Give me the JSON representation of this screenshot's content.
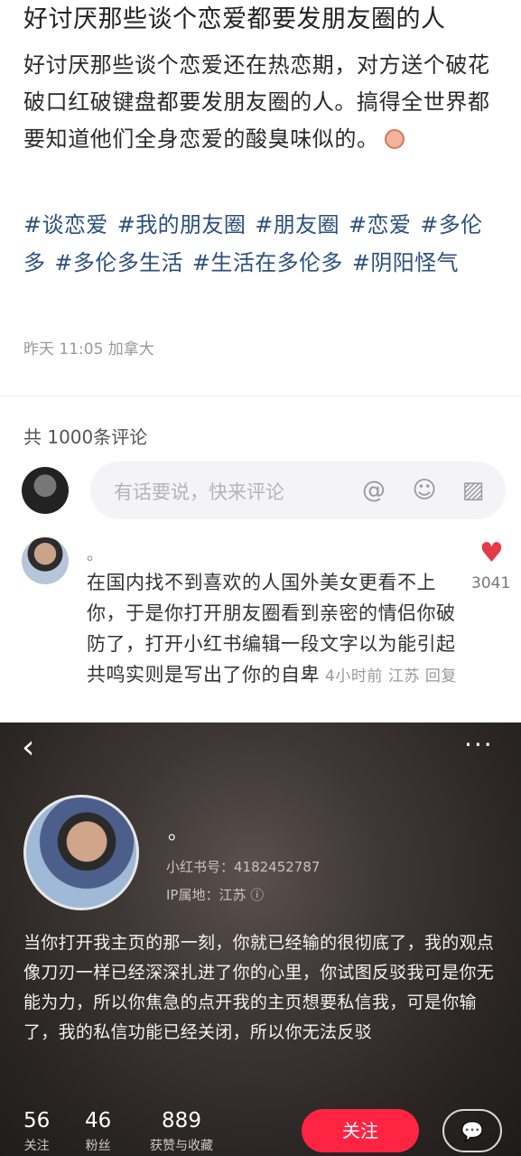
{
  "post": {
    "title": "好讨厌那些谈个恋爱都要发朋友圈的人",
    "body": "好讨厌那些谈个恋爱还在热恋期，对方送个破花破口红破键盘都要发朋友圈的人。搞得全世界都要知道他们全身恋爱的酸臭味似的。",
    "tags": [
      "#谈恋爱",
      "#我的朋友圈",
      "#朋友圈",
      "#恋爱",
      "#多伦多",
      "#多伦多生活",
      "#生活在多伦多",
      "#阴阳怪气"
    ],
    "meta": "昨天 11:05 加拿大"
  },
  "comments": {
    "count_label": "共 1000条评论",
    "input_placeholder": "有话要说，快来评论",
    "icons": [
      "at-icon",
      "emoji-icon",
      "image-icon"
    ],
    "top_comment": {
      "author": "。",
      "text": "在国内找不到喜欢的人国外美女更看不上你，于是你打开朋友圈看到亲密的情侣你破防了，打开小红书编辑一段文字以为能引起共鸣实则是写出了你的自卑",
      "time": "4小时前",
      "location": "江苏",
      "reply_label": "回复",
      "likes": "3041",
      "like_color": "#e63946"
    }
  },
  "profile": {
    "name": "。",
    "id_label": "小红书号：4182452787",
    "ip_label": "IP属地：江苏 ⓘ",
    "bio": "当你打开我主页的那一刻，你就已经输的很彻底了，我的观点像刀刃一样已经深深扎进了你的心里，你试图反驳我可是你无能为力，所以你焦急的点开我的主页想要私信我，可是你输了，我的私信功能已经关闭，所以你无法反驳",
    "stats": [
      {
        "num": "56",
        "label": "关注"
      },
      {
        "num": "46",
        "label": "粉丝"
      },
      {
        "num": "889",
        "label": "获赞与收藏"
      }
    ],
    "follow_label": "关注",
    "accent": "#ff2442"
  }
}
